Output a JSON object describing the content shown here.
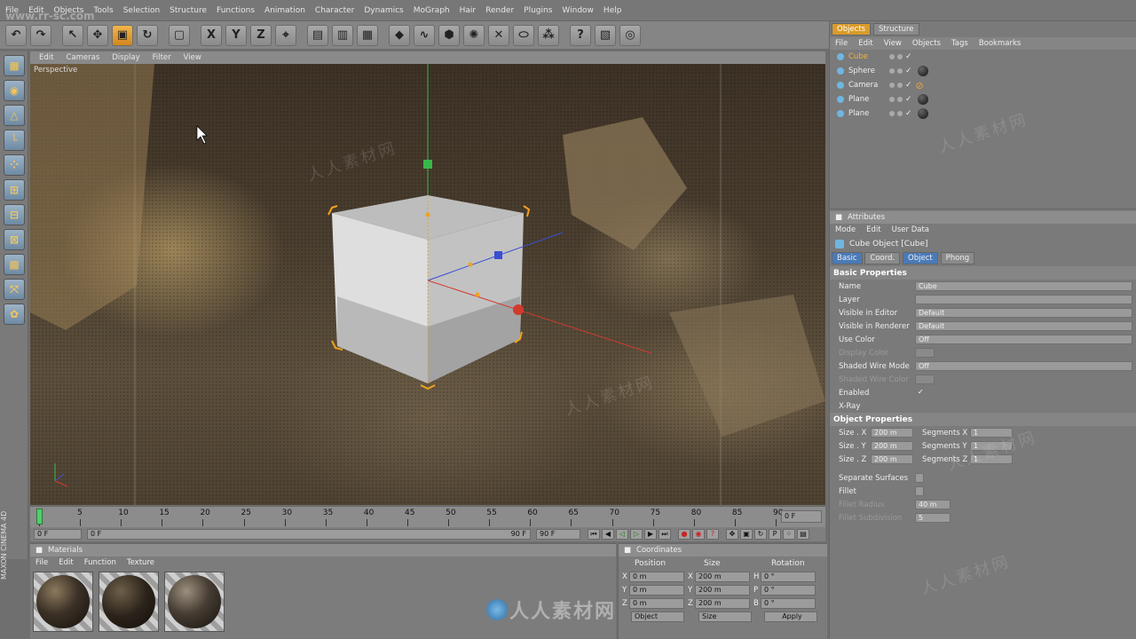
{
  "menu": [
    "File",
    "Edit",
    "Objects",
    "Tools",
    "Selection",
    "Structure",
    "Functions",
    "Animation",
    "Character",
    "Dynamics",
    "MoGraph",
    "Hair",
    "Render",
    "Plugins",
    "Window",
    "Help"
  ],
  "overlay_watermark_url": "www.rr-sc.com",
  "viewport": {
    "menu": [
      "Edit",
      "Cameras",
      "Display",
      "Filter",
      "View"
    ],
    "label": "Perspective"
  },
  "timeline": {
    "ticks": [
      "0",
      "5",
      "10",
      "15",
      "20",
      "25",
      "30",
      "35",
      "40",
      "45",
      "50",
      "55",
      "60",
      "65",
      "70",
      "75",
      "80",
      "85",
      "90"
    ],
    "current_frame": "0 F"
  },
  "playbar": {
    "start": "0 F",
    "range_start": "0 F",
    "range_end": "90 F",
    "end": "90 F"
  },
  "materials": {
    "title": "Materials",
    "menu": [
      "File",
      "Edit",
      "Function",
      "Texture"
    ],
    "count": 3
  },
  "coordinates": {
    "title": "Coordinates",
    "columns": [
      "Position",
      "Size",
      "Rotation"
    ],
    "rows": [
      {
        "axis": "X",
        "pos": "0 m",
        "size_axis": "X",
        "size": "200 m",
        "rot_axis": "H",
        "rot": "0 °"
      },
      {
        "axis": "Y",
        "pos": "0 m",
        "size_axis": "Y",
        "size": "200 m",
        "rot_axis": "P",
        "rot": "0 °"
      },
      {
        "axis": "Z",
        "pos": "0 m",
        "size_axis": "Z",
        "size": "200 m",
        "rot_axis": "B",
        "rot": "0 °"
      }
    ],
    "mode_select": "Object",
    "size_select": "Size",
    "apply": "Apply"
  },
  "objects_panel": {
    "tabs": [
      "Objects",
      "Structure"
    ],
    "menu": [
      "File",
      "Edit",
      "View",
      "Objects",
      "Tags",
      "Bookmarks"
    ],
    "items": [
      {
        "name": "Cube",
        "selected": true
      },
      {
        "name": "Sphere",
        "selected": false
      },
      {
        "name": "Camera",
        "selected": false
      },
      {
        "name": "Plane",
        "selected": false
      },
      {
        "name": "Plane",
        "selected": false
      }
    ]
  },
  "attributes": {
    "title": "Attributes",
    "menu": [
      "Mode",
      "Edit",
      "User Data"
    ],
    "object_title": "Cube Object [Cube]",
    "tabs": [
      "Basic",
      "Coord.",
      "Object",
      "Phong"
    ],
    "basic_title": "Basic Properties",
    "basic": [
      {
        "label": "Name",
        "value": "Cube",
        "dim": false
      },
      {
        "label": "Layer",
        "value": "",
        "dim": false
      },
      {
        "label": "Visible in Editor",
        "value": "Default",
        "dim": false
      },
      {
        "label": "Visible in Renderer",
        "value": "Default",
        "dim": false
      },
      {
        "label": "Use Color",
        "value": "Off",
        "dim": false
      },
      {
        "label": "Display Color",
        "value": "",
        "dim": true
      },
      {
        "label": "Shaded Wire Mode",
        "value": "Off",
        "dim": false
      },
      {
        "label": "Shaded Wire Color",
        "value": "",
        "dim": true
      },
      {
        "label": "Enabled",
        "value": "✓",
        "dim": false
      },
      {
        "label": "X-Ray",
        "value": "",
        "dim": false
      }
    ],
    "object_title2": "Object Properties",
    "size": [
      {
        "label": "Size . X",
        "value": "200 m",
        "seg_label": "Segments X",
        "seg": "1"
      },
      {
        "label": "Size . Y",
        "value": "200 m",
        "seg_label": "Segments Y",
        "seg": "1"
      },
      {
        "label": "Size . Z",
        "value": "200 m",
        "seg_label": "Segments Z",
        "seg": "1"
      }
    ],
    "extra": [
      {
        "label": "Separate Surfaces",
        "value": "",
        "dim": false
      },
      {
        "label": "Fillet",
        "value": "",
        "dim": false
      },
      {
        "label": "Fillet Radius",
        "value": "40 m",
        "dim": true
      },
      {
        "label": "Fillet Subdivision",
        "value": "5",
        "dim": true
      }
    ]
  },
  "side_brand": "MAXON CINEMA 4D",
  "watermark_bottom": "人人素材网",
  "colors": {
    "accent": "#d99b2b",
    "axis_y": "#38b84a",
    "axis_x": "#d23a2e",
    "axis_z": "#3a4fd2"
  }
}
